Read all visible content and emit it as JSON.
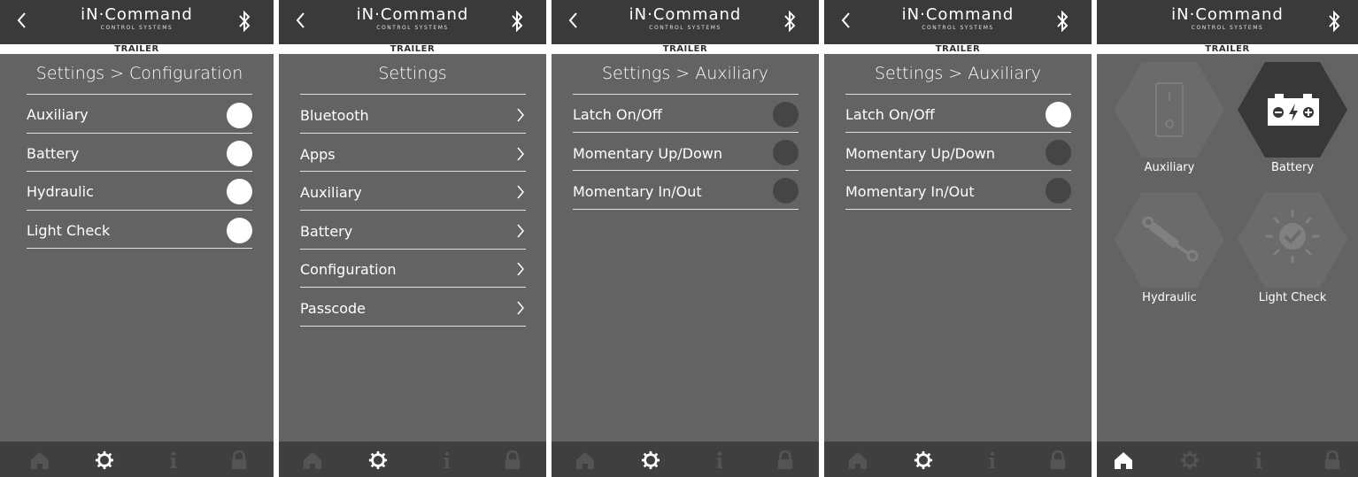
{
  "app": {
    "logo_main": "iN·Command",
    "logo_sub": "CONTROL SYSTEMS",
    "mode": "TRAILER"
  },
  "screens": [
    {
      "title": "Settings > Configuration",
      "rows": [
        {
          "label": "Auxiliary",
          "state": "on"
        },
        {
          "label": "Battery",
          "state": "on"
        },
        {
          "label": "Hydraulic",
          "state": "on"
        },
        {
          "label": "Light Check",
          "state": "on"
        }
      ]
    },
    {
      "title": "Settings",
      "rows": [
        {
          "label": "Bluetooth"
        },
        {
          "label": "Apps"
        },
        {
          "label": "Auxiliary"
        },
        {
          "label": "Battery"
        },
        {
          "label": "Configuration"
        },
        {
          "label": "Passcode"
        }
      ]
    },
    {
      "title": "Settings > Auxiliary",
      "rows": [
        {
          "label": "Latch On/Off",
          "state": "off"
        },
        {
          "label": "Momentary Up/Down",
          "state": "off"
        },
        {
          "label": "Momentary In/Out",
          "state": "off"
        }
      ]
    },
    {
      "title": "Settings > Auxiliary",
      "rows": [
        {
          "label": "Latch On/Off",
          "state": "on"
        },
        {
          "label": "Momentary Up/Down",
          "state": "off"
        },
        {
          "label": "Momentary In/Out",
          "state": "off"
        }
      ]
    },
    {
      "tiles": [
        {
          "label": "Auxiliary",
          "icon": "switch-icon",
          "active": false
        },
        {
          "label": "Battery",
          "icon": "battery-icon",
          "active": true
        },
        {
          "label": "Hydraulic",
          "icon": "hydraulic-cylinder-icon",
          "active": false
        },
        {
          "label": "Light Check",
          "icon": "light-check-icon",
          "active": false
        }
      ]
    }
  ],
  "footer_icons": [
    "home-icon",
    "gear-icon",
    "info-icon",
    "lock-icon"
  ],
  "colors": {
    "background": "#636363",
    "header": "#3a3a3a",
    "footer": "#3f3f3f",
    "toggle_on": "#ffffff",
    "toggle_off": "#454545",
    "icon_active": "#ffffff",
    "icon_dim": "#545454"
  }
}
